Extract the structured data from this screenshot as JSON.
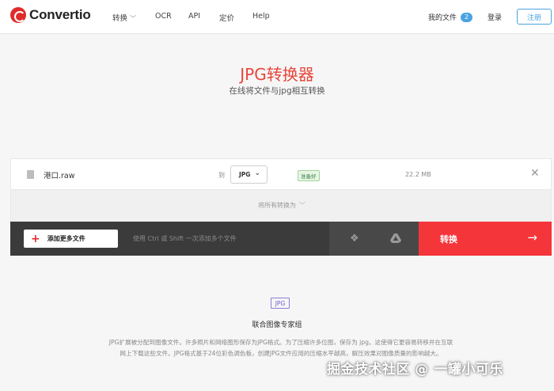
{
  "header": {
    "logo_text": "Convertio",
    "nav": [
      {
        "label": "转换",
        "has_dropdown": true
      },
      {
        "label": "OCR"
      },
      {
        "label": "API"
      },
      {
        "label": "定价"
      },
      {
        "label": "Help"
      }
    ],
    "my_files_label": "我的文件",
    "my_files_count": "2",
    "login_label": "登录",
    "register_label": "注册"
  },
  "hero": {
    "title": "JPG转换器",
    "subtitle": "在线将文件与jpg相互转换"
  },
  "file_row": {
    "file_name": "港口.raw",
    "to_label": "到",
    "target_format": "JPG",
    "status": "准备好",
    "file_size": "22.2 MB"
  },
  "convert_all": {
    "label": "将所有转换为"
  },
  "action_bar": {
    "add_files_label": "添加更多文件",
    "hint": "使用 Ctrl 或 Shift 一次添加多个文件",
    "convert_label": "转换"
  },
  "info": {
    "format_tag": "JPG",
    "title": "联合图像专家组",
    "description": "JPG扩展被分配到图像文件。许多照片和网络图形保存为JPG格式。为了压缩许多位图，保存为 jpg。这使得它更容易转移并在互联网上下载这些文件。JPG格式基于24位彩色调色板，创建JPG文件应用的压缩水平越高，解压效果对图像质量的影响越大。"
  },
  "watermark": "掘金技术社区 @ 一罐小可乐",
  "colors": {
    "brand_red": "#e02b2b",
    "title_red": "#e8463a",
    "convert_button": "#f4353a",
    "accent_blue": "#4aa3df",
    "action_bar": "#3b3b3b"
  },
  "icons": [
    "convertio-logo-icon",
    "chevron-down-icon",
    "file-icon",
    "close-icon",
    "plus-icon",
    "dropbox-icon",
    "google-drive-icon",
    "arrow-right-icon"
  ]
}
